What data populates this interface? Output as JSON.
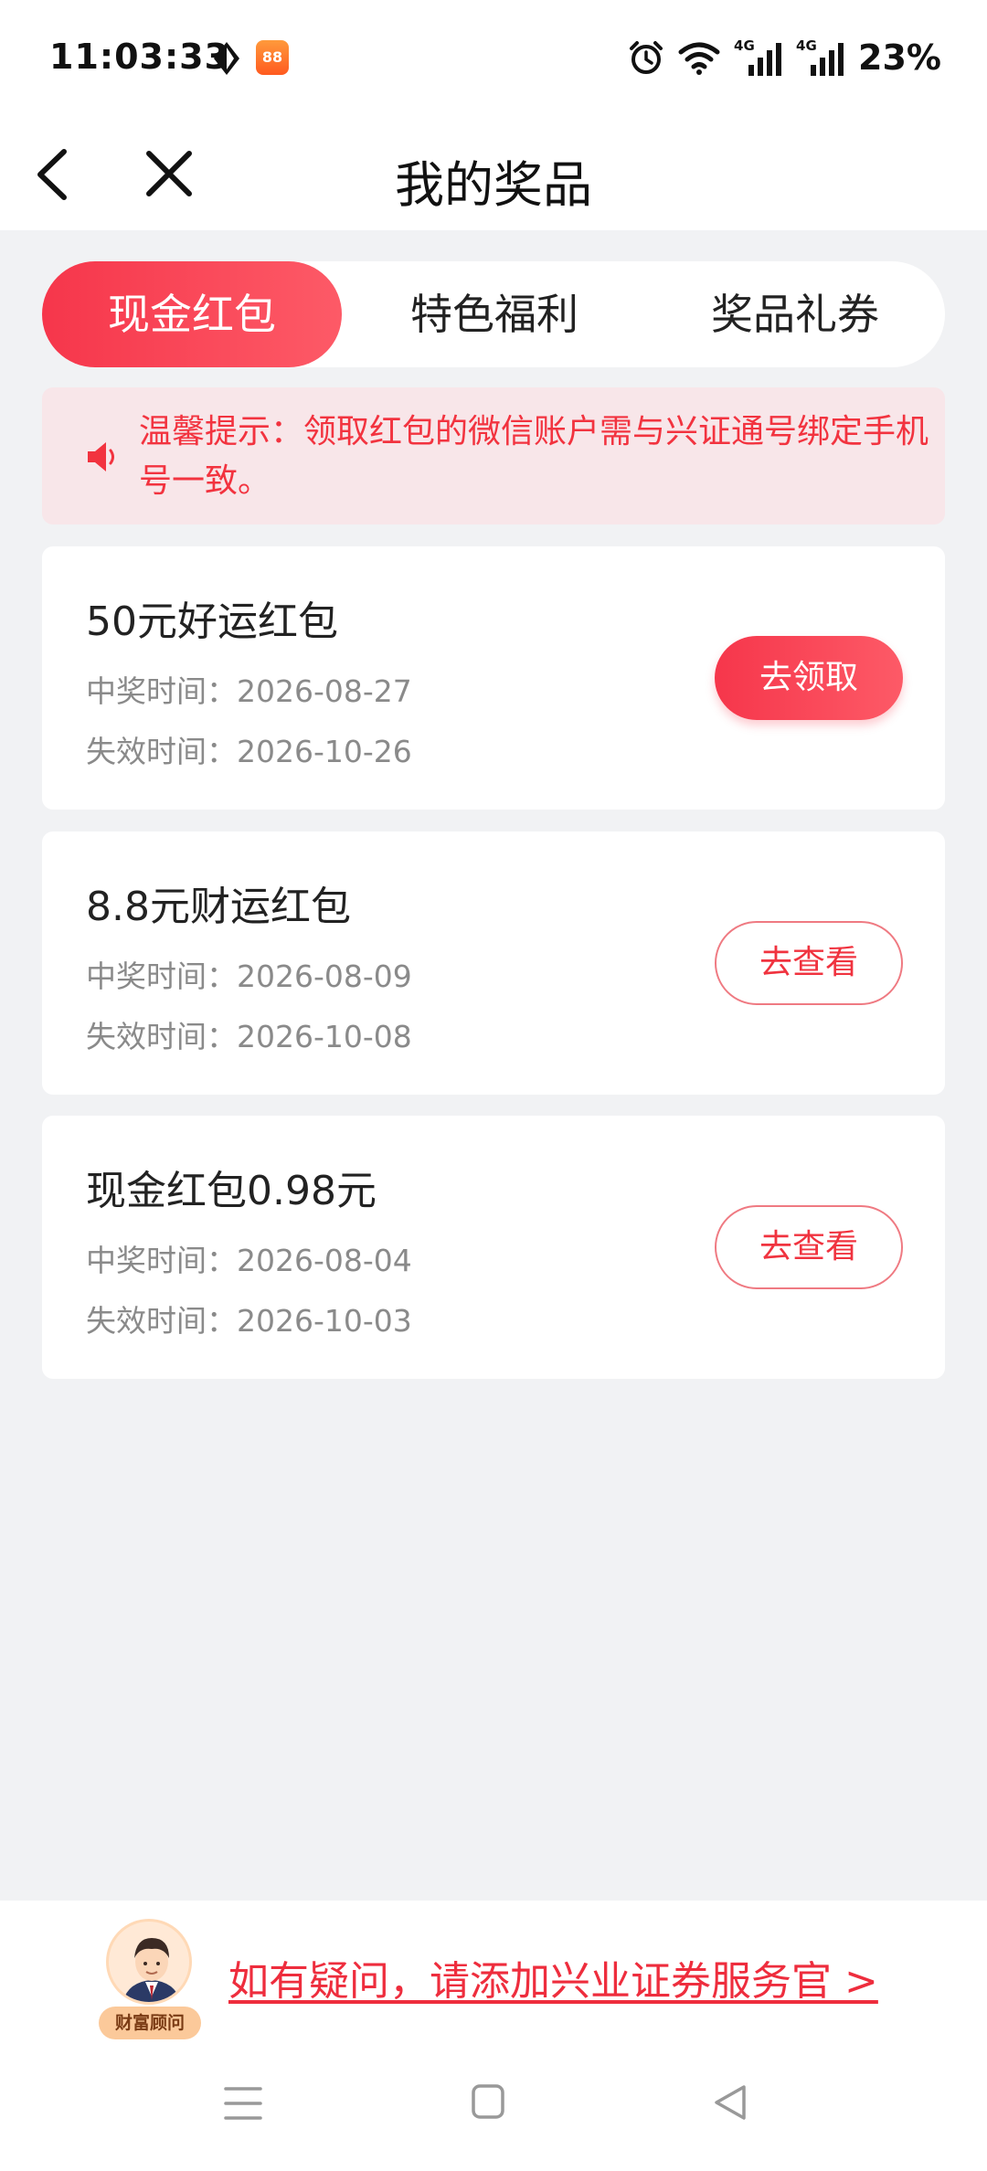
{
  "status_bar": {
    "time": "11:03:33",
    "app_badge": "88",
    "network_1": "4G",
    "network_2": "4G",
    "battery": "23%"
  },
  "nav": {
    "title": "我的奖品",
    "back_icon": "back-arrow-icon",
    "close_icon": "close-icon"
  },
  "tabs": [
    {
      "label": "现金红包",
      "active": true
    },
    {
      "label": "特色福利",
      "active": false
    },
    {
      "label": "奖品礼券",
      "active": false
    }
  ],
  "notice": {
    "icon": "speaker-icon",
    "text": "温馨提示：领取红包的微信账户需与兴证通号绑定手机号一致。"
  },
  "prizes": [
    {
      "title": "50元好运红包",
      "win_time": "中奖时间：2026-08-27",
      "expire_time": "失效时间：2026-10-26",
      "button": "去领取"
    },
    {
      "title": "8.8元财运红包",
      "win_time": "中奖时间：2026-08-09",
      "expire_time": "失效时间：2026-10-08",
      "button": "去查看"
    },
    {
      "title": "现金红包0.98元",
      "win_time": "中奖时间：2026-08-04",
      "expire_time": "失效时间：2026-10-03",
      "button": "去查看"
    }
  ],
  "footer": {
    "advisor_badge": "财富顾问",
    "help_link": "如有疑问，请添加兴业证券服务官 >"
  },
  "colors": {
    "accent": "#f6364b",
    "background": "#f1f2f4",
    "notice_bg": "#f8e6e9"
  }
}
